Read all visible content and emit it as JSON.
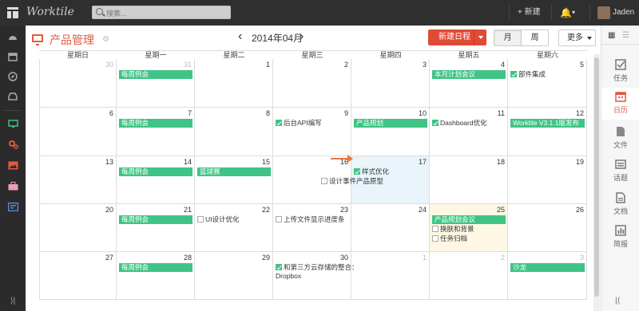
{
  "topbar": {
    "brand": "Worktile",
    "search_placeholder": "搜索...",
    "new_label": "+ 新建",
    "user_name": "Jaden"
  },
  "project": {
    "title": "产品管理"
  },
  "calendar_nav": {
    "prev": "‹",
    "next": "›",
    "month": "2014年04月",
    "new_schedule": "新建日程",
    "view_month": "月",
    "view_week": "周",
    "more": "更多"
  },
  "weekdays": [
    "星期日",
    "星期一",
    "星期二",
    "星期三",
    "星期四",
    "星期五",
    "星期六"
  ],
  "dates": [
    [
      "30",
      "31",
      "1",
      "2",
      "3",
      "4",
      "5"
    ],
    [
      "6",
      "7",
      "8",
      "9",
      "10",
      "11",
      "12"
    ],
    [
      "13",
      "14",
      "15",
      "16",
      "17",
      "18",
      "19"
    ],
    [
      "20",
      "21",
      "22",
      "23",
      "24",
      "25",
      "26"
    ],
    [
      "27",
      "28",
      "29",
      "30",
      "1",
      "2",
      "3"
    ]
  ],
  "events": {
    "e1": "每周例会",
    "e2": "本月计划会议",
    "e3": "部件集成",
    "e4": "每周例会",
    "e5": "后台API编写",
    "e6": "产品规划",
    "e7": "Dashboard优化",
    "e8": "Worktile V3.1.1版发布",
    "e9": "每周例会",
    "e10": "篮球赛",
    "e11": "设计事件产品原型",
    "e12": "样式优化",
    "e13": "每周例会",
    "e14": "UI设计优化",
    "e15": "上传文件显示进度条",
    "e16": "产品规划会议",
    "e17": "换肤和背景",
    "e18": "任务归档",
    "e19": "每周例会",
    "e20": "和第三方云存储的整合：",
    "e21": "Dropbox",
    "e22": "沙龙"
  },
  "rightbar": {
    "task": "任务",
    "cal": "日历",
    "file": "文件",
    "topic": "话题",
    "doc": "文档",
    "report": "简报"
  },
  "colors": {
    "accent": "#e3593f",
    "event": "#3fc486",
    "today": "#e9f4fb"
  }
}
